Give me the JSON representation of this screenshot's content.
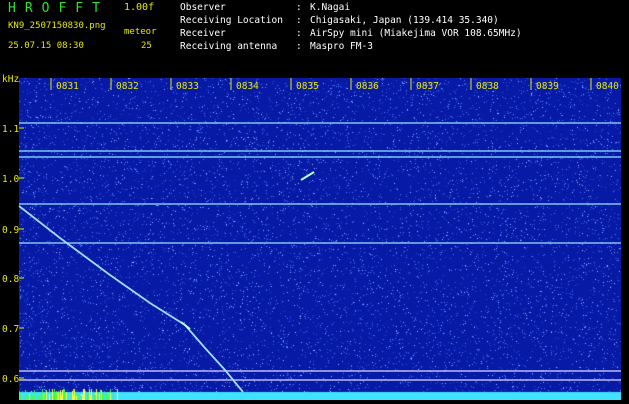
{
  "header": {
    "app_title": "HROFFT",
    "version": "1.00f",
    "filename": "KN9_2507150830.png",
    "datetime": "25.07.15 08:30",
    "meteor_label": "meteor",
    "meteor_count": "25"
  },
  "info": [
    {
      "key": "Observer",
      "value": "K.Nagai"
    },
    {
      "key": "Receiving Location",
      "value": "Chigasaki, Japan (139.414 35.340)"
    },
    {
      "key": "Receiver",
      "value": "AirSpy mini (Miakejima VOR 108.65MHz)"
    },
    {
      "key": "Receiving antenna",
      "value": "Maspro FM-3"
    }
  ],
  "spectrogram": {
    "y_unit": "kHz",
    "y_ticks": [
      "1.1",
      "1.0",
      "0.9",
      "0.8",
      "0.7",
      "0.6"
    ],
    "x_ticks": [
      "0831",
      "0832",
      "0833",
      "0834",
      "0835",
      "0836",
      "0837",
      "0838",
      "0839",
      "0840"
    ],
    "colors": {
      "background": "#071aa6",
      "noise": "#4f7cff",
      "carrier": "#8fe3ff",
      "ticks": "#e8e800",
      "bottom_band": "#3fe2ff"
    }
  }
}
